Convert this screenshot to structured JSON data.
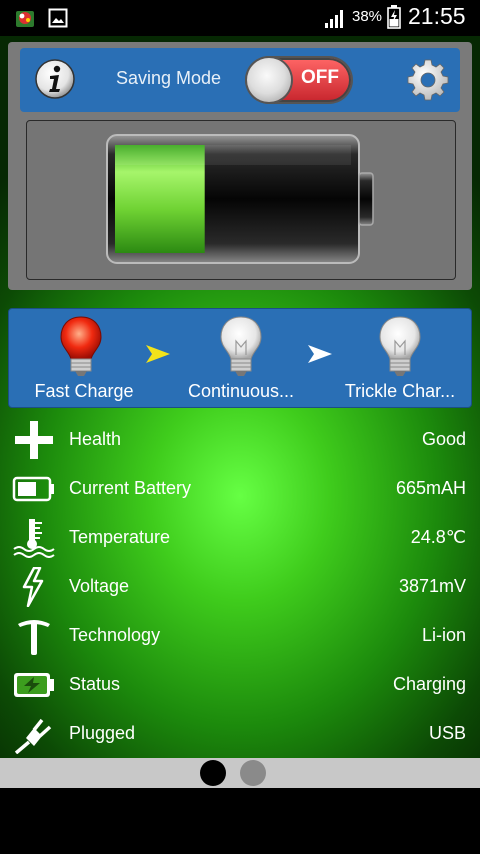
{
  "status_bar": {
    "battery_percent": "38%",
    "time": "21:55"
  },
  "toolbar": {
    "saving_mode_label": "Saving Mode",
    "saving_mode_toggle": "OFF"
  },
  "battery_level_fraction": 0.38,
  "charge_stages": [
    {
      "label": "Fast Charge",
      "state": "active"
    },
    {
      "label": "Continuous...",
      "state": "inactive"
    },
    {
      "label": "Trickle Char...",
      "state": "inactive"
    }
  ],
  "info": {
    "health": {
      "label": "Health",
      "value": "Good",
      "icon": "cross-icon"
    },
    "current_battery": {
      "label": "Current Battery",
      "value": "665mAH",
      "icon": "battery-icon"
    },
    "temperature": {
      "label": "Temperature",
      "value": "24.8℃",
      "icon": "thermometer-icon"
    },
    "voltage": {
      "label": "Voltage",
      "value": "3871mV",
      "icon": "lightning-icon"
    },
    "technology": {
      "label": "Technology",
      "value": "Li-ion",
      "icon": "pickaxe-icon"
    },
    "status": {
      "label": "Status",
      "value": "Charging",
      "icon": "charging-battery-icon"
    },
    "plugged": {
      "label": "Plugged",
      "value": "USB",
      "icon": "plug-icon"
    }
  },
  "pager": {
    "pages": 2,
    "active_index": 0
  },
  "colors": {
    "toolbar_blue": "#2a6fb5",
    "toggle_red": "#d9343a",
    "battery_green": "#7be53e",
    "background_green": "#3fcc1c"
  }
}
